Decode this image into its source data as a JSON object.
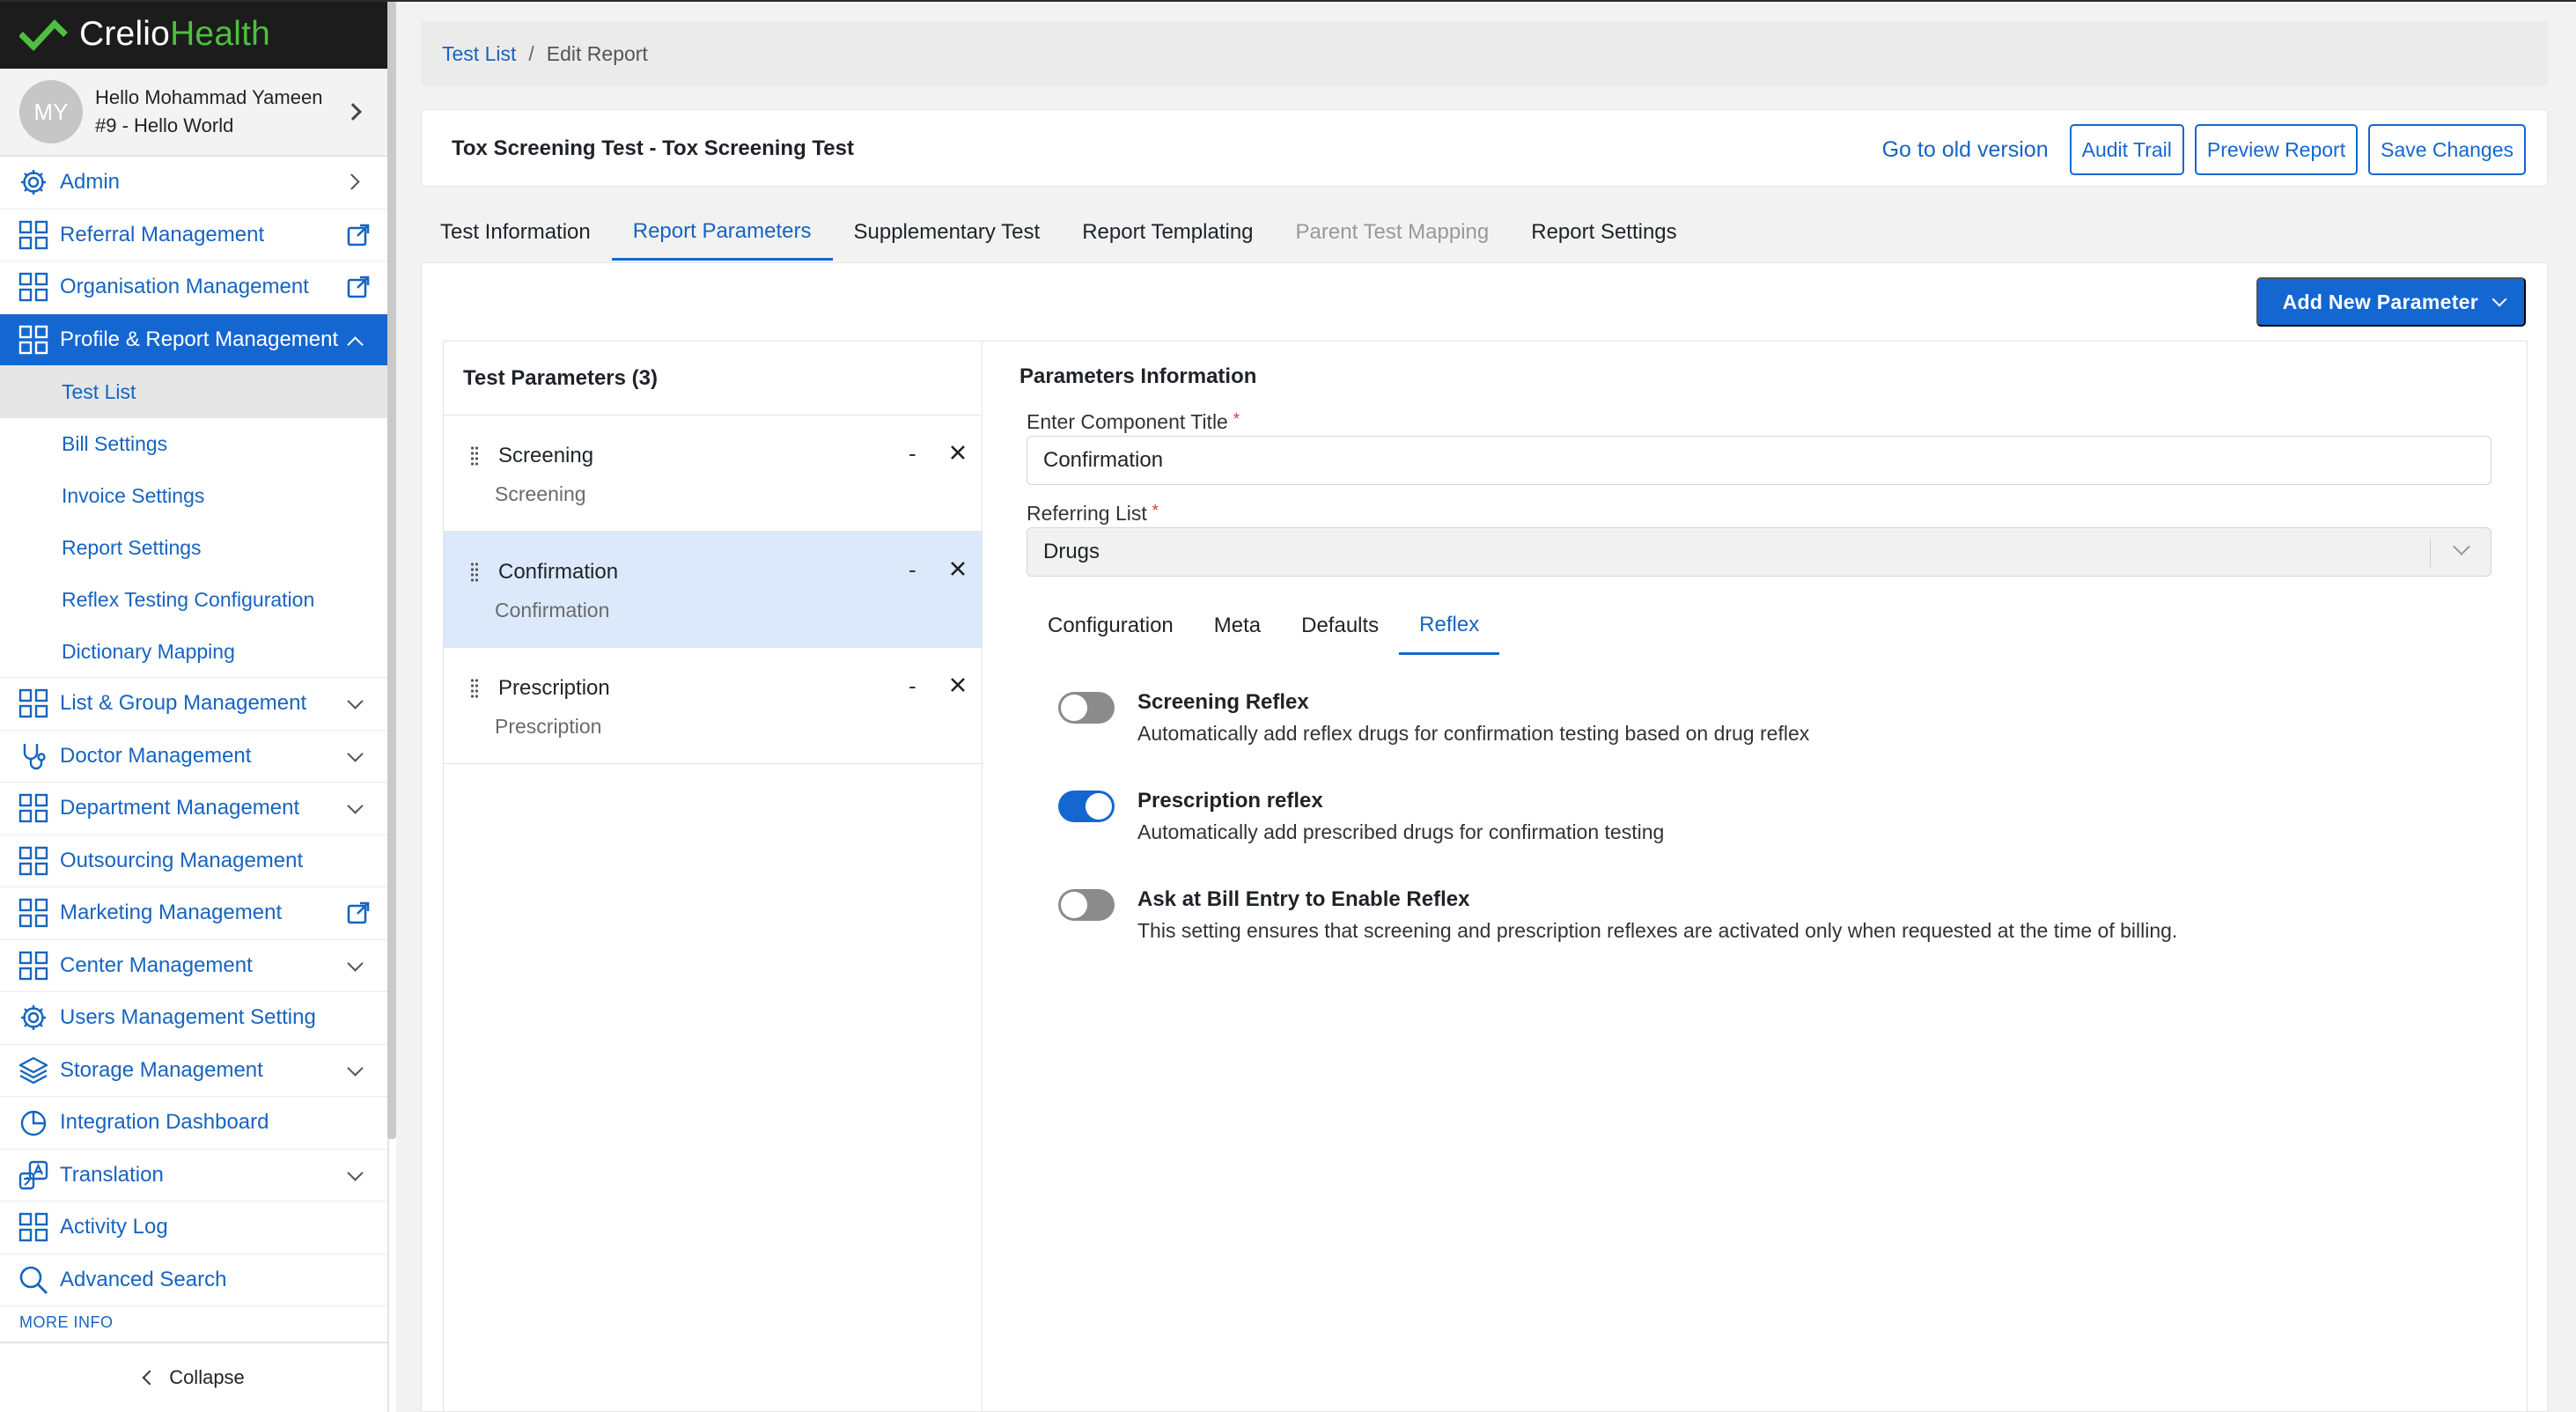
{
  "brand": {
    "name_part1": "Crelio",
    "name_part2": "Health",
    "accent": "#4fbf3f"
  },
  "user": {
    "initials": "MY",
    "greeting": "Hello Mohammad Yameen",
    "account": "#9 - Hello World"
  },
  "sidebar": {
    "items": [
      {
        "label": "Admin",
        "icon": "gear-icon"
      },
      {
        "label": "Referral Management",
        "icon": "grid-icon",
        "trail": "external-link-icon"
      },
      {
        "label": "Organisation Management",
        "icon": "grid-icon",
        "trail": "external-link-icon"
      },
      {
        "label": "Profile & Report Management",
        "icon": "grid-icon",
        "trail": "chevron-up-icon"
      },
      {
        "label": "List & Group Management",
        "icon": "grid-icon"
      },
      {
        "label": "Doctor Management",
        "icon": "stethoscope-icon"
      },
      {
        "label": "Department Management",
        "icon": "grid-icon"
      },
      {
        "label": "Outsourcing Management",
        "icon": "grid-icon"
      },
      {
        "label": "Marketing Management",
        "icon": "grid-icon"
      },
      {
        "label": "Center Management",
        "icon": "grid-icon"
      },
      {
        "label": "Users Management Setting",
        "icon": "gear-icon"
      },
      {
        "label": "Storage Management",
        "icon": "layers-icon"
      },
      {
        "label": "Integration Dashboard",
        "icon": "pie-icon"
      },
      {
        "label": "Translation",
        "icon": "translate-icon"
      },
      {
        "label": "Activity Log",
        "icon": "grid-icon"
      },
      {
        "label": "Advanced Search",
        "icon": "search-icon"
      }
    ],
    "sub_items": [
      "Test List",
      "Bill Settings",
      "Invoice Settings",
      "Report Settings",
      "Reflex Testing Configuration",
      "Dictionary Mapping"
    ],
    "more_info": "MORE INFO",
    "collapse": "Collapse"
  },
  "breadcrumb": {
    "link": "Test List",
    "separator": "/",
    "current": "Edit Report"
  },
  "header": {
    "title": "Tox Screening Test - Tox Screening Test",
    "old_version": "Go to old version",
    "audit_trail": "Audit Trail",
    "preview_report": "Preview Report",
    "save_changes": "Save Changes"
  },
  "tabs": [
    "Test Information",
    "Report Parameters",
    "Supplementary Test",
    "Report Templating",
    "Parent Test Mapping",
    "Report Settings"
  ],
  "add_parameter": "Add New Parameter",
  "params": {
    "heading": "Test Parameters (3)",
    "rows": [
      {
        "name": "Screening",
        "sub": "Screening",
        "minus": "-"
      },
      {
        "name": "Confirmation",
        "sub": "Confirmation",
        "minus": "-"
      },
      {
        "name": "Prescription",
        "sub": "Prescription",
        "minus": "-"
      }
    ]
  },
  "info": {
    "heading": "Parameters Information",
    "title_label": "Enter Component Title",
    "title_value": "Confirmation",
    "list_label": "Referring List",
    "list_value": "Drugs",
    "required_mark": "*",
    "tabs": [
      "Configuration",
      "Meta",
      "Defaults",
      "Reflex"
    ],
    "toggles": [
      {
        "title": "Screening Reflex",
        "desc": "Automatically add reflex drugs for confirmation testing based on drug reflex",
        "on": false
      },
      {
        "title": "Prescription reflex",
        "desc": "Automatically add prescribed drugs for confirmation testing",
        "on": true
      },
      {
        "title": "Ask at Bill Entry to Enable Reflex",
        "desc": "This setting ensures that screening and prescription reflexes are activated only when requested at the time of billing.",
        "on": false
      }
    ]
  },
  "colors": {
    "primary": "#1467d1",
    "link": "#1764c0",
    "sidebar_dark": "#1c1c1c"
  }
}
